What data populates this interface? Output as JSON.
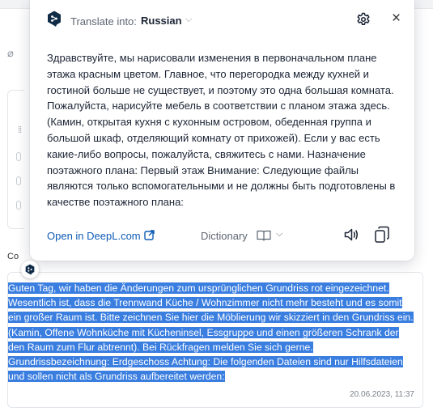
{
  "popup": {
    "translate_into_label": "Translate into:",
    "language": "Russian",
    "translation": "Здравствуйте, мы нарисовали изменения в первоначальном плане этажа красным цветом. Главное, что перегородка между кухней и гостиной больше не существует, и поэтому это одна большая комната. Пожалуйста, нарисуйте мебель в соответствии с планом этажа здесь. (Камин, открытая кухня с кухонным островом, обеденная группа и большой шкаф, отделяющий комнату от прихожей). Если у вас есть какие-либо вопросы, пожалуйста, свяжитесь с нами. Назначение поэтажного плана: Первый этаж Внимание: Следующие файлы являются только вспомогательными и не должны быть подготовлены в качестве поэтажного плана:",
    "open_link": "Open in DeepL.com",
    "dictionary_label": "Dictionary",
    "icons": [
      "deepl-logo",
      "settings-icon",
      "close-icon",
      "external-link-icon",
      "book-icon",
      "speaker-icon",
      "copy-icon"
    ],
    "link_color": "#0f5bb5",
    "logo_color": "#0f2b46"
  },
  "background": {
    "label": "Co"
  },
  "comment": {
    "text": "Guten Tag, wir haben die Änderungen zum ursprünglichen Grundriss rot eingezeichnet. Wesentlich ist, dass die Trennwand Küche / Wohnzimmer nicht mehr besteht und es somit ein großer Raum ist. Bitte zeichnen Sie hier die Möblierung wir skizziert in den Grundriss ein. (Kamin, Offene Wohnküche mit Kücheninsel, Essgruppe und einen größeren Schrank der den Raum zum Flur abtrennt). Bei Rückfragen melden Sie sich gerne. Grundrissbezeichnung: Erdgeschoss Achtung: Die folgenden Dateien sind nur Hilfsdateien und sollen nicht als Grundriss aufbereitet werden:",
    "timestamp": "20.06.2023, 11:37",
    "selection_color": "#3a7ee0"
  }
}
